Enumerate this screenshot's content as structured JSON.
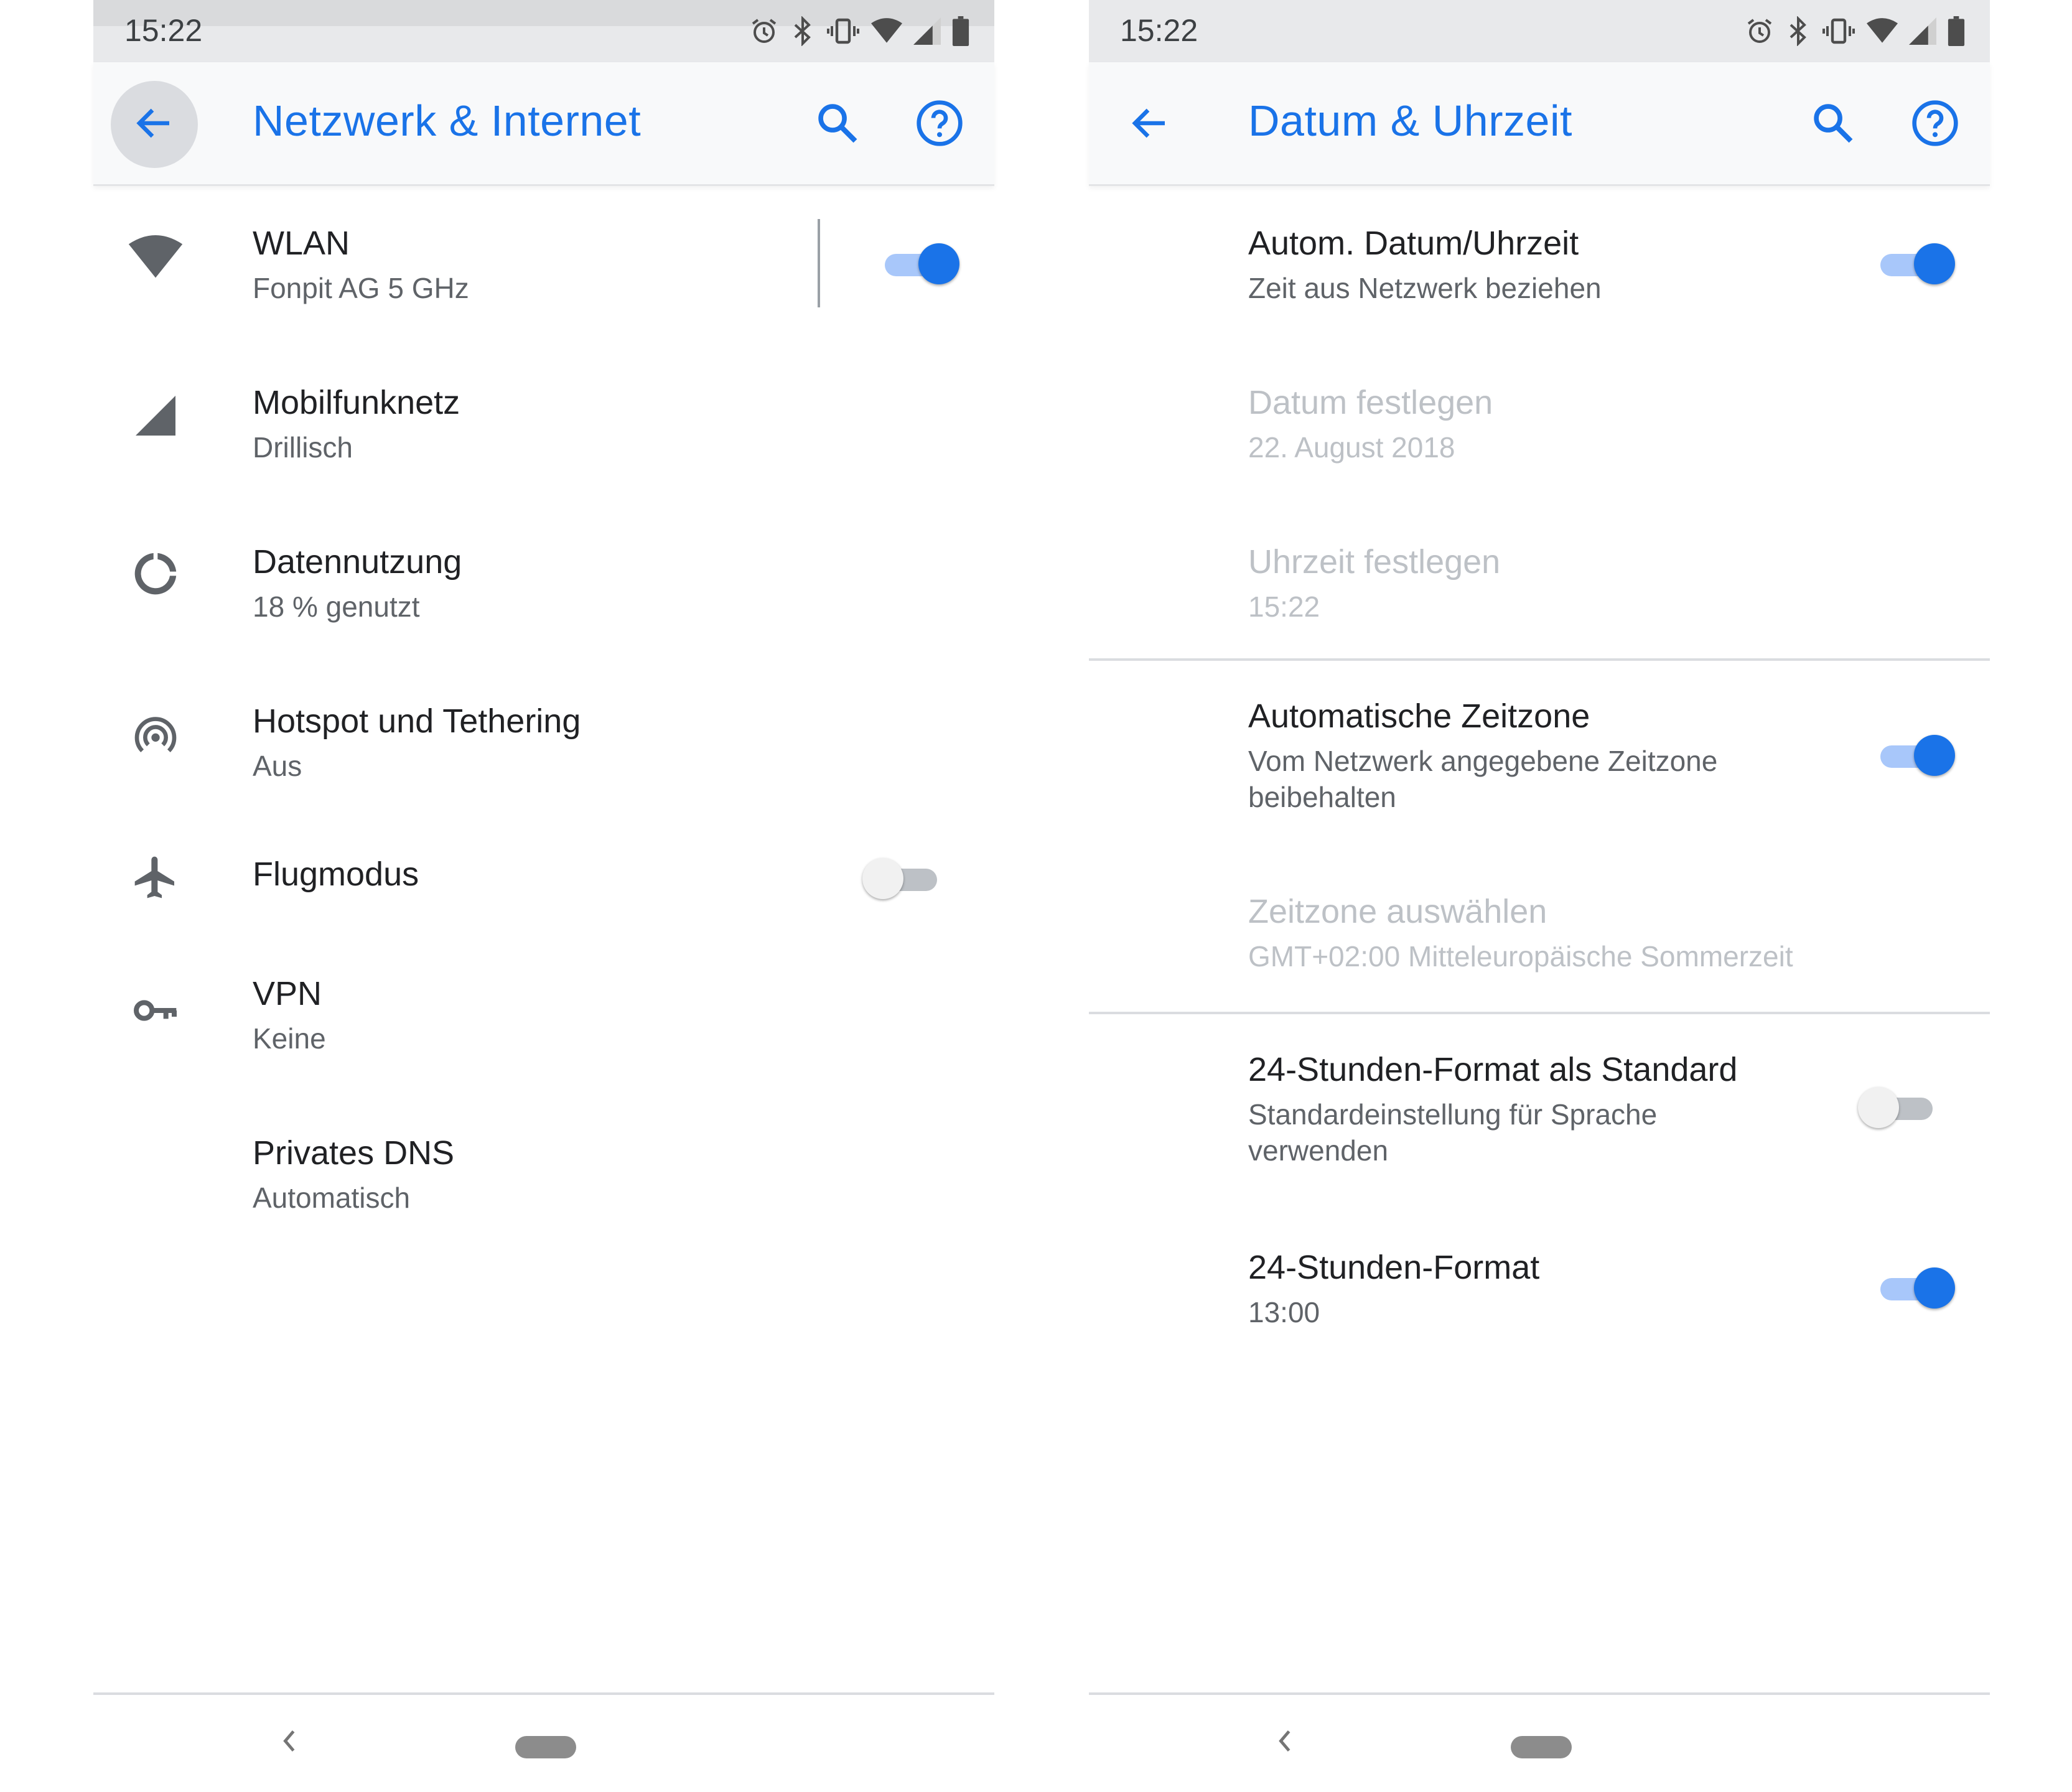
{
  "colors": {
    "accent": "#1a73e8",
    "toggle_on_track": "#a8c7fa",
    "icon_gray": "#5f6368",
    "disabled_text": "#bdc1c6"
  },
  "left_screen": {
    "status": {
      "time": "15:22",
      "icons": [
        "alarm-icon",
        "bluetooth-icon",
        "vibrate-icon",
        "wifi-icon",
        "signal-icon",
        "battery-icon"
      ]
    },
    "appbar": {
      "title": "Netzwerk & Internet",
      "icons": [
        "back-arrow-icon",
        "search-icon",
        "help-icon"
      ]
    },
    "items": [
      {
        "title": "WLAN",
        "subtitle": "Fonpit AG 5 GHz",
        "icon": "wifi-icon",
        "toggle": true
      },
      {
        "title": "Mobilfunknetz",
        "subtitle": "Drillisch",
        "icon": "signal-icon"
      },
      {
        "title": "Datennutzung",
        "subtitle": "18 % genutzt",
        "icon": "data-usage-icon"
      },
      {
        "title": "Hotspot und Tethering",
        "subtitle": "Aus",
        "icon": "hotspot-icon"
      },
      {
        "title": "Flugmodus",
        "icon": "airplane-icon",
        "toggle": false
      },
      {
        "title": "VPN",
        "subtitle": "Keine",
        "icon": "vpn-key-icon"
      },
      {
        "title": "Privates DNS",
        "subtitle": "Automatisch"
      }
    ],
    "nav": {
      "icons": [
        "nav-back-icon",
        "nav-home-pill"
      ]
    }
  },
  "right_screen": {
    "status": {
      "time": "15:22",
      "icons": [
        "alarm-icon",
        "bluetooth-icon",
        "vibrate-icon",
        "wifi-icon",
        "signal-icon",
        "battery-icon"
      ]
    },
    "appbar": {
      "title": "Datum & Uhrzeit",
      "icons": [
        "back-arrow-icon",
        "search-icon",
        "help-icon"
      ]
    },
    "items": [
      {
        "title": "Autom. Datum/Uhrzeit",
        "subtitle": "Zeit aus Netzwerk beziehen",
        "toggle": true
      },
      {
        "title": "Datum festlegen",
        "subtitle": "22. August 2018",
        "disabled": true
      },
      {
        "title": "Uhrzeit festlegen",
        "subtitle": "15:22",
        "disabled": true
      },
      {
        "title": "Automatische Zeitzone",
        "subtitle": "Vom Netzwerk angegebene Zeitzone beibehalten",
        "toggle": true
      },
      {
        "title": "Zeitzone auswählen",
        "subtitle": "GMT+02:00 Mitteleuropäische Sommerzeit",
        "disabled": true
      },
      {
        "title": "24-Stunden-Format als Standard",
        "subtitle": "Standardeinstellung für Sprache verwenden",
        "toggle": false
      },
      {
        "title": "24-Stunden-Format",
        "subtitle": "13:00",
        "toggle": true
      }
    ],
    "nav": {
      "icons": [
        "nav-back-icon",
        "nav-home-pill"
      ]
    }
  }
}
